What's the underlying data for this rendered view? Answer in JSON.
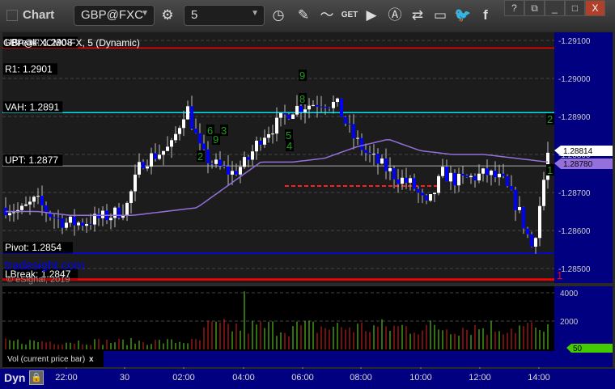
{
  "window": {
    "title": "Chart",
    "symbol": "GBP@FXC",
    "interval": "5",
    "buttons": {
      "help": "?",
      "minimize": "_",
      "close": "X"
    }
  },
  "toolbar_icons": [
    "settings-gear-icon",
    "clock-icon",
    "pencil-icon",
    "study-icon",
    "get-icon",
    "play-icon",
    "alert-icon",
    "link-icon",
    "comment-icon",
    "twitter-icon",
    "facebook-icon"
  ],
  "chart": {
    "symbol_title": "GBP@FXCM0-FX, 5 (Dynamic)",
    "watermark": "tradesight.com",
    "copyright": "© eSignal, 2019",
    "levels": [
      {
        "label": "UBreak: 1.2908",
        "price": 1.2908,
        "color": "#ff0000"
      },
      {
        "label": "R1: 1.2901",
        "price": 1.2901,
        "color": ""
      },
      {
        "label": "VAH: 1.2891",
        "price": 1.2891,
        "color": "#00e5ee"
      },
      {
        "label": "UPT: 1.2877",
        "price": 1.2877,
        "color": "#aaaaaa"
      },
      {
        "label": "Pivot: 1.2854",
        "price": 1.2854,
        "color": "#0000ff"
      },
      {
        "label": "LBreak: 1.2847",
        "price": 1.2847,
        "color": "#ff0000"
      }
    ],
    "price_axis": [
      "1.29100",
      "1.29000",
      "1.28900",
      "1.28800",
      "1.28700",
      "1.28600",
      "1.28500"
    ],
    "last_price": "1.28814",
    "ma_price": "1.28780",
    "colors": {
      "up": "#ffffff",
      "down": "#0000ff",
      "ma": "#9370db",
      "vol_up": "#66dd22",
      "vol_down": "#dd2222"
    },
    "closes": [
      1.2866,
      1.2865,
      1.2868,
      1.2864,
      1.2862,
      1.2862,
      1.2863,
      1.2864,
      1.2866,
      1.2878,
      1.288,
      1.2882,
      1.2893,
      1.288,
      1.2877,
      1.2875,
      1.2878,
      1.2885,
      1.2888,
      1.2892,
      1.2893,
      1.2894,
      1.2893,
      1.2885,
      1.288,
      1.2877,
      1.2874,
      1.2872,
      1.2866,
      1.2875,
      1.2873,
      1.2874,
      1.2875,
      1.2873,
      1.2866,
      1.2855,
      1.288
    ],
    "ma": [
      1.2865,
      1.2865,
      1.2864,
      1.2864,
      1.2864,
      1.2865,
      1.2866,
      1.2872,
      1.2878,
      1.2878,
      1.2879,
      1.2882,
      1.2884,
      1.2881,
      1.288,
      1.288,
      1.2879,
      1.2878
    ],
    "counts": [
      "9",
      "8",
      "6",
      "9",
      "2",
      "5",
      "4",
      "3",
      "2",
      "1"
    ]
  },
  "volume": {
    "label": "Vol (current price bar)",
    "close": "x",
    "axis": [
      "4000",
      "2000"
    ],
    "current": "50"
  },
  "time_axis": {
    "mode": "Dyn",
    "labels": [
      "22:00",
      "30",
      "02:00",
      "04:00",
      "06:00",
      "08:00",
      "10:00",
      "12:00",
      "14:00"
    ]
  }
}
